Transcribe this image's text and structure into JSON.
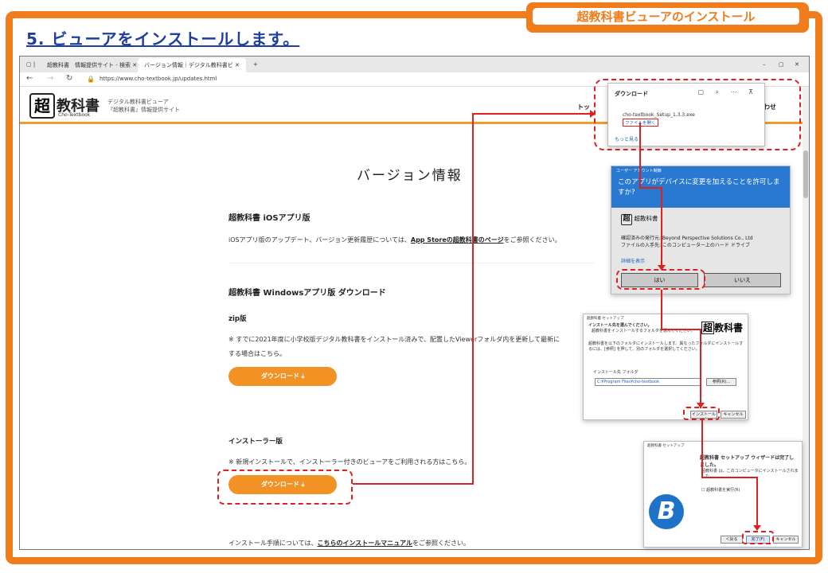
{
  "header": {
    "tag": "超教科書ビューアのインストール",
    "step_title": "5. ビューアをインストールします。"
  },
  "browser": {
    "tabs": [
      "超教科書　情報提供サイト - 検索",
      "バージョン情報｜デジタル教科書ビ"
    ],
    "url": "https://www.cho-textbook.jp/updates.html"
  },
  "site": {
    "logo_char": "超",
    "logo_text": "教科書",
    "logo_sub": "Cho-Textbook",
    "desc_line1": "デジタル教科書ビューア",
    "desc_line2": "『超教科書』情報提供サイト",
    "nav_top": "トッ",
    "nav_right": "わせ"
  },
  "page": {
    "title": "バージョン情報",
    "ios_heading": "超教科書 iOSアプリ版",
    "ios_text_prefix": "iOSアプリ版のアップデート、バージョン更新履歴については、",
    "ios_link": "App Storeの超教科書のページ",
    "ios_text_suffix": "をご参照ください。",
    "win_heading": "超教科書 Windowsアプリ版 ダウンロード",
    "zip_heading": "zip版",
    "zip_text_line1": "※ すでに2021年度に小学校版デジタル教科書をインストール済みで、配置したViewerフォルダ内を更新して最新に",
    "zip_text_line2": "する場合はこちら。",
    "download_label": "ダウンロード",
    "installer_heading": "インストーラー版",
    "installer_text": "※ 新規インストールで、インストーラー付きのビューアをご利用される方はこちら。",
    "manual_prefix": "インストール手順については、",
    "manual_link": "こちらのインストールマニュアル",
    "manual_suffix": "をご参照ください。"
  },
  "download_panel": {
    "title": "ダウンロード",
    "file": "cho-textbook_Setup_1.3.3.exe",
    "open": "ファイルを開く",
    "more": "もっと見る"
  },
  "uac": {
    "label": "ユーザー アカウント制御",
    "question": "このアプリがデバイスに変更を加えることを許可しますか?",
    "app": "超教科書",
    "publisher": "確認済みの発行元: Beyond Perspective Solutions Co., Ltd",
    "origin": "ファイルの入手先: このコンピューター上のハード ドライブ",
    "detail": "詳細を表示",
    "yes": "はい",
    "no": "いいえ"
  },
  "setup1": {
    "title": "超教科書 セットアップ",
    "heading": "インストール先を選んでください。",
    "sub": "超教科書をインストールするフォルダを選んでください。",
    "body": "超教科書を以下のフォルダにインストールします。異なったフォルダにインストールするには、[参照] を押して、別のフォルダを選択してください。",
    "folder_label": "インストール先 フォルダ",
    "folder_path": "C:¥Program Files¥cho-textbook",
    "browse": "参照(R)...",
    "install": "インストール",
    "cancel": "キャンセル",
    "logo_text": "教科書"
  },
  "setup2": {
    "title": "超教科書 セットアップ",
    "heading": "超教科書 セットアップ ウィザードは完了しました。",
    "body": "超教科書 は、このコンピュータにインストールされました。",
    "checkbox": "超教科書を実行(R)",
    "back": "＜戻る",
    "finish": "完了(F)",
    "cancel": "キャンセル"
  },
  "colors": {
    "accent": "#f07c1c",
    "button": "#f39224",
    "marker": "#e02020",
    "title": "#1f3fa0"
  }
}
